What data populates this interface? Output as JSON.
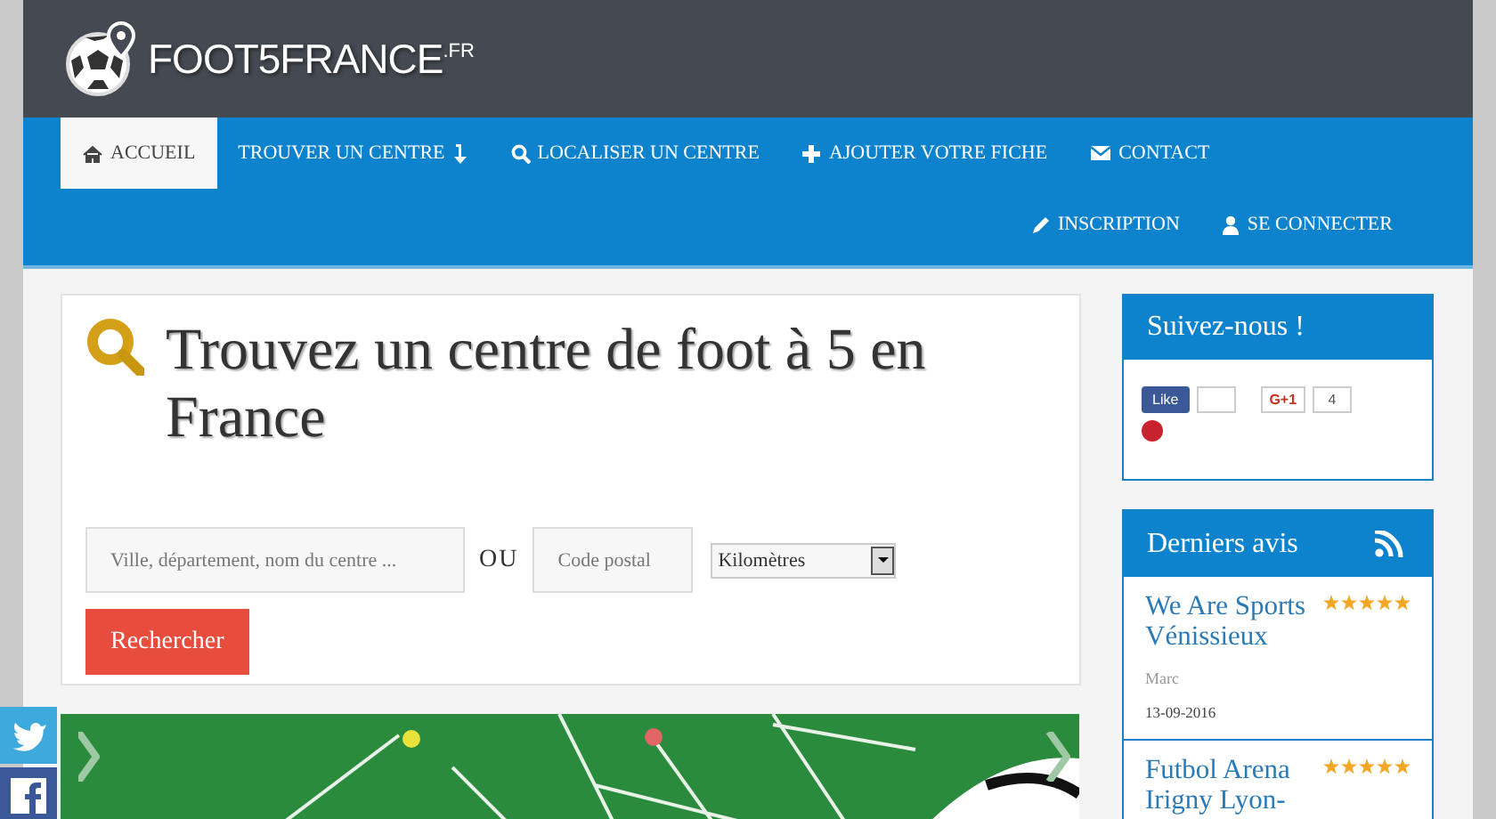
{
  "logo": {
    "name": "FOOT5FRANCE",
    "suffix": ".FR"
  },
  "nav": {
    "primary_items": [
      {
        "label": "ACCUEIL",
        "selected": true
      },
      {
        "label": "TROUVER UN CENTRE",
        "selected": false
      },
      {
        "label": "LOCALISER UN CENTRE",
        "selected": false
      },
      {
        "label": "AJOUTER VOTRE FICHE",
        "selected": false
      },
      {
        "label": "CONTACT",
        "selected": false
      }
    ],
    "secondary_items": [
      {
        "label": "INSCRIPTION",
        "selected": false
      },
      {
        "label": "SE CONNECTER",
        "selected": false
      }
    ]
  },
  "search_card": {
    "heading": "Trouvez un centre de foot à 5 en France",
    "location_field": {
      "placeholder": "Ville, département, nom du centre ..."
    },
    "separator": "OU",
    "postal_field": {
      "placeholder": "Code postal"
    },
    "unit_select": {
      "value": "Kilomètres"
    },
    "submit_button": "Rechercher"
  },
  "follow_widget": {
    "title": "Suivez-nous !",
    "like_button": "Like",
    "plus_button": "G+1",
    "plus_count": "4"
  },
  "reviews_widget": {
    "title": "Derniers avis",
    "reviews": [
      {
        "name": "We Are Sports Vénissieux",
        "stars": 5,
        "author": "Marc",
        "date": "13-09-2016"
      },
      {
        "name": "Futbol Arena Irigny Lyon-",
        "stars": 5
      }
    ]
  }
}
